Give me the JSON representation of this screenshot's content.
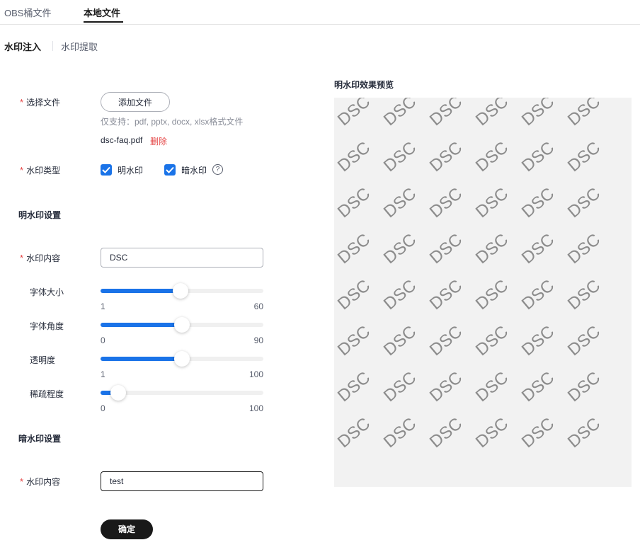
{
  "tabs": [
    {
      "label": "OBS桶文件",
      "active": false
    },
    {
      "label": "本地文件",
      "active": true
    }
  ],
  "subtabs": [
    {
      "label": "水印注入",
      "active": true
    },
    {
      "label": "水印提取",
      "active": false
    }
  ],
  "form": {
    "select_file_label": "选择文件",
    "add_file_button": "添加文件",
    "supported_hint": "仅支持：pdf, pptx, docx, xlsx格式文件",
    "file_name": "dsc-faq.pdf",
    "delete_link": "删除",
    "watermark_type_label": "水印类型",
    "visible_checkbox_label": "明水印",
    "visible_checked": true,
    "invisible_checkbox_label": "暗水印",
    "invisible_checked": true,
    "help_icon": "question-circle-icon",
    "visible_section_title": "明水印设置",
    "visible_content_label": "水印内容",
    "visible_content_value": "DSC",
    "sliders": [
      {
        "label": "字体大小",
        "min": "1",
        "max": "60",
        "value_fraction": 0.49
      },
      {
        "label": "字体角度",
        "min": "0",
        "max": "90",
        "value_fraction": 0.5
      },
      {
        "label": "透明度",
        "min": "1",
        "max": "100",
        "value_fraction": 0.5
      },
      {
        "label": "稀疏程度",
        "min": "0",
        "max": "100",
        "value_fraction": 0.11
      }
    ],
    "invisible_section_title": "暗水印设置",
    "invisible_content_label": "水印内容",
    "invisible_content_value": "test",
    "confirm_button": "确定"
  },
  "preview": {
    "title": "明水印效果预览",
    "watermark_text": "DSC",
    "background": "#f2f2f2"
  },
  "colors": {
    "accent": "#1a73e8",
    "required": "#e54545",
    "primary_button": "#191919"
  }
}
